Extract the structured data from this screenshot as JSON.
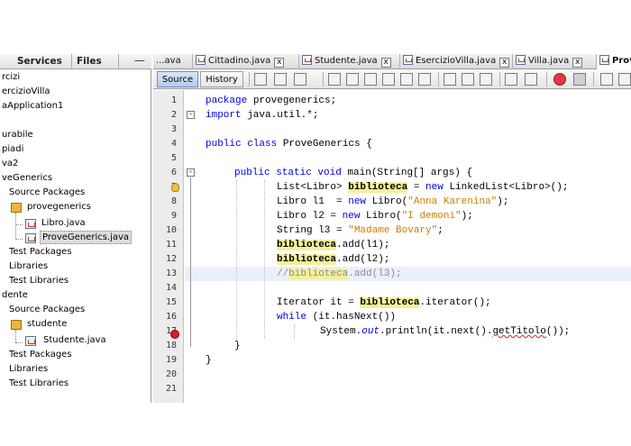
{
  "left_panel": {
    "tabs": [
      "Services",
      "Files"
    ],
    "minimize": "—",
    "tree": [
      {
        "label": "rcizi",
        "icon": "none"
      },
      {
        "label": "ercizioVilla",
        "icon": "none"
      },
      {
        "label": "aApplication1",
        "icon": "none"
      },
      {
        "label": "",
        "icon": "none"
      },
      {
        "label": "urabile",
        "icon": "none"
      },
      {
        "label": "piadi",
        "icon": "none"
      },
      {
        "label": "va2",
        "icon": "none"
      },
      {
        "label": "veGenerics",
        "icon": "none"
      },
      {
        "label": "Source Packages",
        "icon": "none"
      },
      {
        "label": "provegenerics",
        "icon": "package-icon"
      },
      {
        "label": "Libro.java",
        "icon": "java-file-icon"
      },
      {
        "label": "ProveGenerics.java",
        "icon": "java-file-icon",
        "selected": true
      },
      {
        "label": "Test Packages",
        "icon": "none"
      },
      {
        "label": "Libraries",
        "icon": "none"
      },
      {
        "label": "Test Libraries",
        "icon": "none"
      },
      {
        "label": "dente",
        "icon": "none"
      },
      {
        "label": "Source Packages",
        "icon": "none"
      },
      {
        "label": "studente",
        "icon": "package-icon"
      },
      {
        "label": "Studente.java",
        "icon": "java-file-icon"
      },
      {
        "label": "Test Packages",
        "icon": "none"
      },
      {
        "label": "Libraries",
        "icon": "none"
      },
      {
        "label": "Test Libraries",
        "icon": "none"
      }
    ]
  },
  "editor_tabs": [
    {
      "label": "...ava",
      "closable": true
    },
    {
      "label": "Cittadino.java",
      "closable": true
    },
    {
      "label": "Studente.java",
      "closable": true
    },
    {
      "label": "EsercizioVilla.java",
      "closable": true
    },
    {
      "label": "Villa.java",
      "closable": true
    },
    {
      "label": "Prov",
      "closable": false,
      "active": true
    }
  ],
  "toolbar": {
    "source_label": "Source",
    "history_label": "History"
  },
  "line_numbers": [
    "1",
    "2",
    "3",
    "4",
    "5",
    "6",
    "7",
    "8",
    "9",
    "10",
    "11",
    "12",
    "13",
    "14",
    "15",
    "16",
    "17",
    "18",
    "19",
    "20",
    "21"
  ],
  "code": {
    "l1_kw": "package",
    "l1_rest": " provegenerics;",
    "l2_kw": "import",
    "l2_rest": " java.util.*;",
    "l4_kw": "public class",
    "l4_rest": " ProveGenerics {",
    "l6_kw": "public static void",
    "l6_rest": " main(String[] args) {",
    "l7_a": "List<Libro> ",
    "l7_hl": "biblioteca",
    "l7_b": " = ",
    "l7_kw": "new",
    "l7_c": " LinkedList<Libro>();",
    "l8_a": "Libro l1  = ",
    "l8_kw": "new",
    "l8_b": " Libro(",
    "l8_str": "\"Anna Karenina\"",
    "l8_c": ");",
    "l9_a": "Libro l2 = ",
    "l9_kw": "new",
    "l9_b": " Libro(",
    "l9_str": "\"I demoni\"",
    "l9_c": ");",
    "l10_a": "String l3 = ",
    "l10_str": "\"Madame Bovary\"",
    "l10_c": ";",
    "l11_hl": "biblioteca",
    "l11_b": ".add(l1);",
    "l12_hl": "biblioteca",
    "l12_b": ".add(l2);",
    "l13_a": "//",
    "l13_hl": "biblioteca",
    "l13_b": ".add(l3);",
    "l15_a": "Iterator it = ",
    "l15_hl": "biblioteca",
    "l15_b": ".iterator();",
    "l16_kw": "while",
    "l16_b": " (it.hasNext())",
    "l17_a": "System.",
    "l17_out": "out",
    "l17_b": ".println(it.next().",
    "l17_sq": "getTitolo",
    "l17_c": "());",
    "l18": "}",
    "l19": "}"
  },
  "colors": {
    "keyword": "#0000e6",
    "string": "#ce7b00",
    "comment": "#888888",
    "highlight": "#f4f09a",
    "source_button": "#b6cdef"
  }
}
